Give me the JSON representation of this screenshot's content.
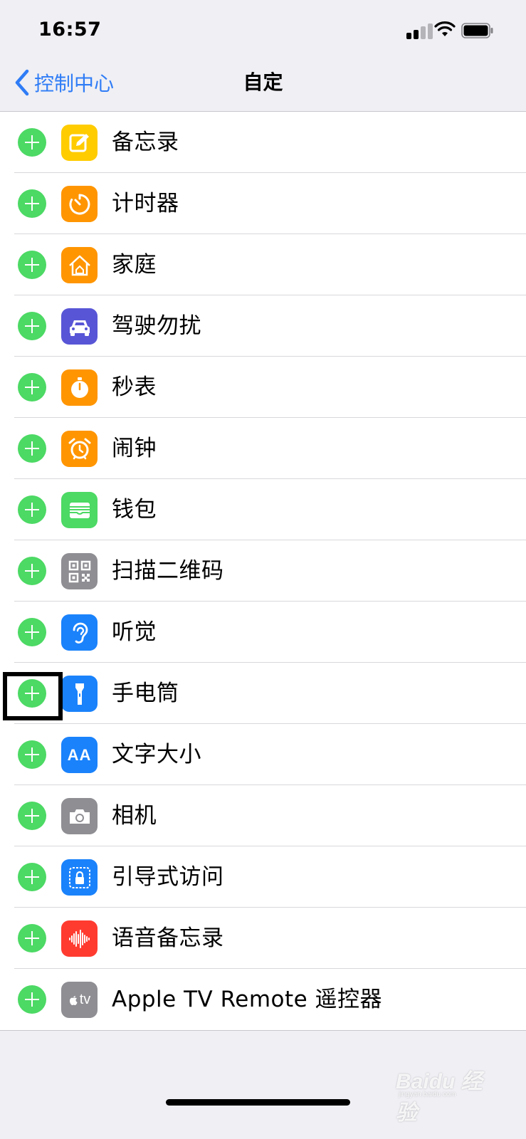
{
  "status_bar": {
    "time": "16:57",
    "icons": [
      "cellular-signal-icon",
      "wifi-icon",
      "battery-icon"
    ]
  },
  "nav": {
    "back_label": "控制中心",
    "title": "自定"
  },
  "colors": {
    "accent_blue": "#2f7cf6",
    "add_green": "#4cd964",
    "background": "#efeff4"
  },
  "rows": [
    {
      "label": "备忘录",
      "icon": "notes-icon",
      "icon_color": "#ffcc00"
    },
    {
      "label": "计时器",
      "icon": "timer-icon",
      "icon_color": "#ff9500"
    },
    {
      "label": "家庭",
      "icon": "home-icon",
      "icon_color": "#ff9500"
    },
    {
      "label": "驾驶勿扰",
      "icon": "car-icon",
      "icon_color": "#5856d6"
    },
    {
      "label": "秒表",
      "icon": "stopwatch-icon",
      "icon_color": "#ff9500"
    },
    {
      "label": "闹钟",
      "icon": "alarm-clock-icon",
      "icon_color": "#ff9500"
    },
    {
      "label": "钱包",
      "icon": "wallet-icon",
      "icon_color": "#4cd964"
    },
    {
      "label": "扫描二维码",
      "icon": "qr-code-icon",
      "icon_color": "#8e8e93"
    },
    {
      "label": "听觉",
      "icon": "ear-icon",
      "icon_color": "#1a82fb"
    },
    {
      "label": "手电筒",
      "icon": "flashlight-icon",
      "icon_color": "#1a82fb"
    },
    {
      "label": "文字大小",
      "icon": "text-size-icon",
      "icon_color": "#1a82fb"
    },
    {
      "label": "相机",
      "icon": "camera-icon",
      "icon_color": "#8e8e93"
    },
    {
      "label": "引导式访问",
      "icon": "guided-access-icon",
      "icon_color": "#1a82fb"
    },
    {
      "label": "语音备忘录",
      "icon": "voice-memos-icon",
      "icon_color": "#ff3b30"
    },
    {
      "label": "Apple TV Remote 遥控器",
      "icon": "apple-tv-remote-icon",
      "icon_color": "#8e8e93"
    }
  ],
  "text_size_glyph": "AA",
  "tv_glyph": "tv",
  "watermark": {
    "main": "Baidu 经验",
    "sub": "jingyan.baidu.com"
  }
}
